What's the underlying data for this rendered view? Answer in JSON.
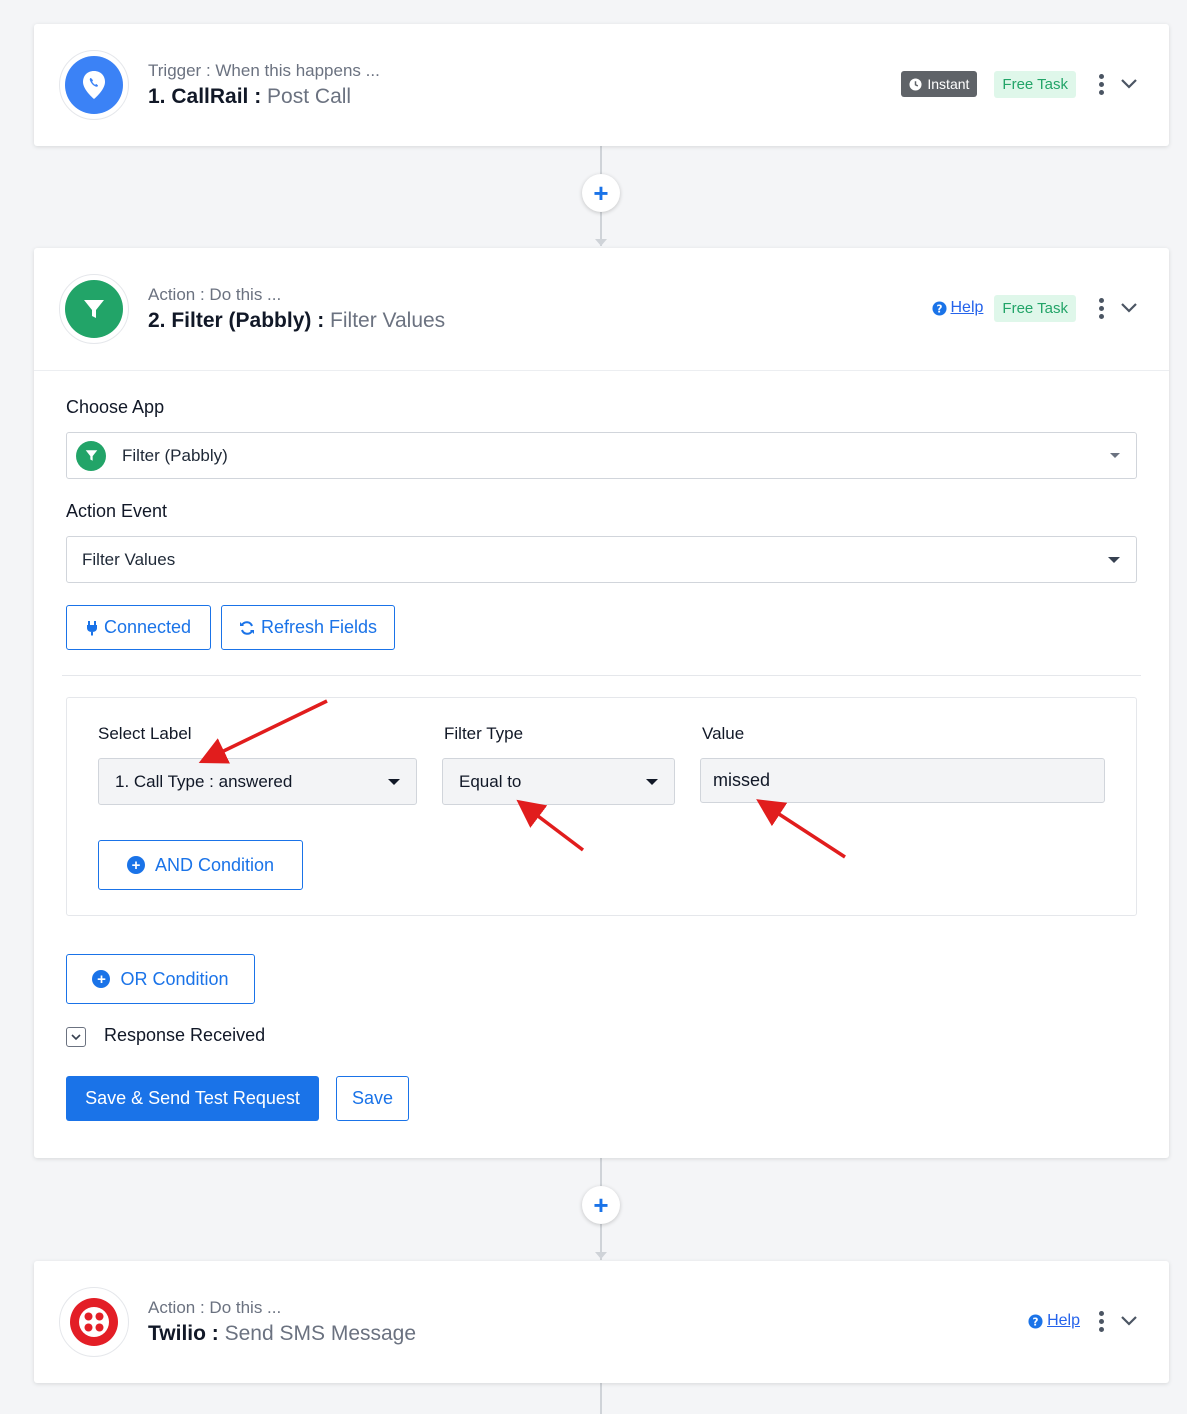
{
  "steps": [
    {
      "sub": "Trigger : When this happens ...",
      "title_strong": "1. CallRail : ",
      "title_event": "Post Call",
      "badge_instant": "Instant",
      "badge_free": "Free Task",
      "icon": "callrail-pin-icon",
      "icon_color": "#3b82f6"
    },
    {
      "sub": "Action : Do this ...",
      "title_strong": "2. Filter (Pabbly) : ",
      "title_event": "Filter Values",
      "help": "Help",
      "badge_free": "Free Task",
      "icon": "filter-funnel-icon",
      "icon_color": "#22a468"
    },
    {
      "sub": "Action : Do this ...",
      "title_strong": "Twilio : ",
      "title_event": "Send SMS Message",
      "help": "Help",
      "icon": "twilio-icon",
      "icon_color": "#e31e26"
    }
  ],
  "form": {
    "choose_app_label": "Choose App",
    "choose_app_value": "Filter (Pabbly)",
    "action_event_label": "Action Event",
    "action_event_value": "Filter Values",
    "connected_label": "Connected",
    "refresh_label": "Refresh Fields",
    "select_label_header": "Select Label",
    "filter_type_header": "Filter Type",
    "value_header": "Value",
    "select_label_value": "1. Call Type : answered",
    "filter_type_value": "Equal to",
    "value_value": "missed",
    "and_condition": "AND Condition",
    "or_condition": "OR Condition",
    "response_received": "Response Received",
    "save_send": "Save & Send Test Request",
    "save": "Save"
  },
  "colors": {
    "primary": "#1a73e8",
    "free_task_bg": "#dff7ea",
    "free_task_text": "#22a468",
    "annotation_arrow": "#e11d1d"
  }
}
